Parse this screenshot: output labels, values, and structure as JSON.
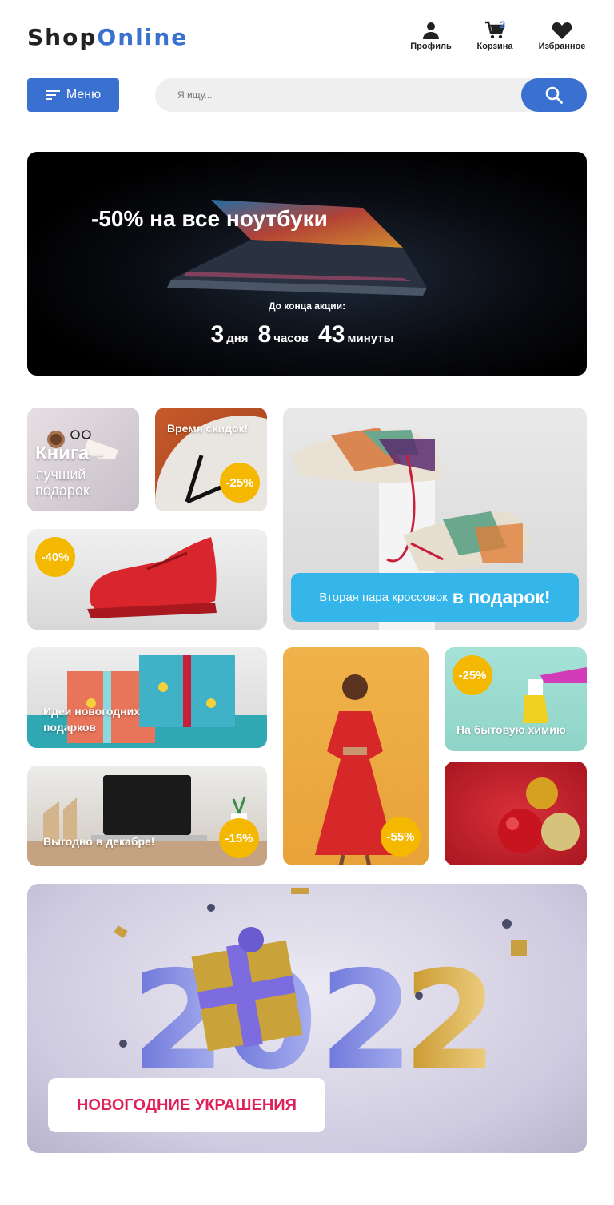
{
  "header": {
    "logo_part1": "Shop",
    "logo_part2": "Online",
    "profile_label": "Профиль",
    "cart_label": "Корзина",
    "cart_count": "2",
    "favorites_label": "Избранное"
  },
  "menu": {
    "label": "Меню"
  },
  "search": {
    "placeholder": "Я ищу..."
  },
  "hero": {
    "title": "-50% на все ноутбуки",
    "subtitle": "До конца акции:",
    "days": "3",
    "days_unit": "дня",
    "hours": "8",
    "hours_unit": "часов",
    "minutes": "43",
    "minutes_unit": "минуты"
  },
  "tiles": {
    "book_title": "Книга",
    "book_dash": "–",
    "book_line2": "лучший",
    "book_line3": "подарок",
    "clock_title": "Время скидок!",
    "clock_discount": "-25%",
    "boot_discount": "-40%",
    "sneakers_small": "Вторая пара кроссовок",
    "sneakers_big": "в подарок!",
    "gifts_label": "Идеи новогодних подарков",
    "dress_discount": "-55%",
    "chem_discount": "-25%",
    "chem_label": "На бытовую химию",
    "laptop_label": "Выгодно в декабре!",
    "laptop_discount": "-15%"
  },
  "newyear": {
    "button_label": "НОВОГОДНИЕ УКРАШЕНИЯ",
    "year_digits": [
      "2",
      "0",
      "2",
      "2"
    ]
  },
  "colors": {
    "accent": "#3a70d0",
    "discount": "#f5b800",
    "promo": "#35b6ea",
    "newyear_text": "#e0205a"
  }
}
